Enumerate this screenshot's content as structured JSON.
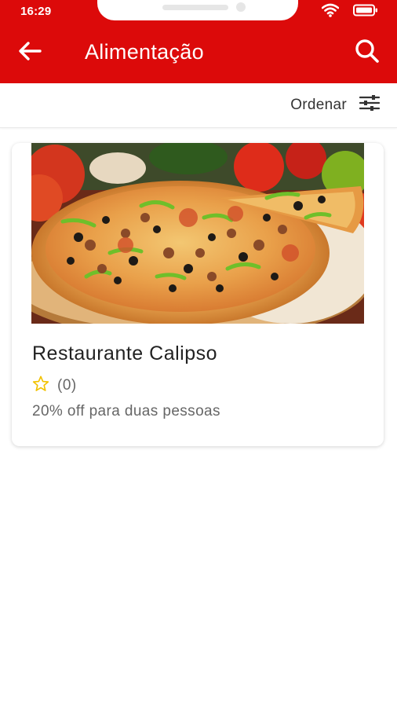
{
  "status_bar": {
    "time": "16:29"
  },
  "header": {
    "title": "Alimentação",
    "icons": [
      "back-arrow-icon",
      "search-icon"
    ],
    "color": "#dc0a0a"
  },
  "sort": {
    "label": "Ordenar",
    "icon": "filter-sliders-icon"
  },
  "results": [
    {
      "name": "Restaurante Calipso",
      "rating_count": "(0)",
      "rating_icon": "star-outline-icon",
      "rating_color": "#f2c200",
      "offer": "20% off para duas pessoas",
      "image": "pizza-photo"
    }
  ]
}
